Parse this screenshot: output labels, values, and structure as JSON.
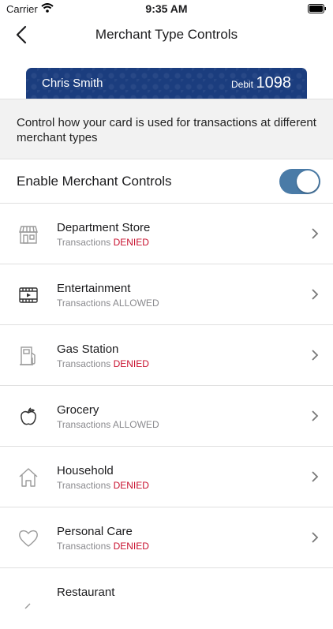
{
  "status_bar": {
    "carrier": "Carrier",
    "time": "9:35 AM"
  },
  "nav": {
    "title": "Merchant Type Controls"
  },
  "card": {
    "name": "Chris Smith",
    "type": "Debit",
    "last4": "1098",
    "color": "#1b3d7e"
  },
  "description": "Control how your card is used for transactions at different merchant types",
  "toggle": {
    "label": "Enable Merchant Controls",
    "on": true,
    "color": "#4a7ba7"
  },
  "status_prefix": "Transactions",
  "merchants": [
    {
      "name": "Department Store",
      "status": "DENIED",
      "icon": "store-icon"
    },
    {
      "name": "Entertainment",
      "status": "ALLOWED",
      "icon": "film-icon"
    },
    {
      "name": "Gas Station",
      "status": "DENIED",
      "icon": "gas-pump-icon"
    },
    {
      "name": "Grocery",
      "status": "ALLOWED",
      "icon": "apple-icon"
    },
    {
      "name": "Household",
      "status": "DENIED",
      "icon": "home-icon"
    },
    {
      "name": "Personal Care",
      "status": "DENIED",
      "icon": "heart-icon"
    },
    {
      "name": "Restaurant",
      "status": "",
      "icon": "fork-icon"
    }
  ],
  "colors": {
    "denied": "#c8102e",
    "muted": "#8a8a8e"
  }
}
